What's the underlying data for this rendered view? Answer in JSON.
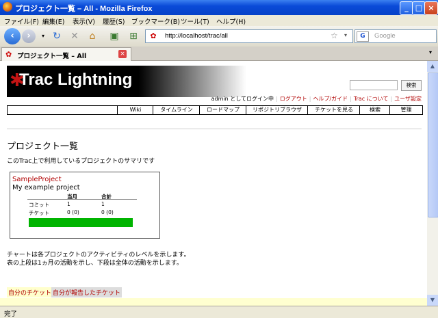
{
  "window": {
    "title": "プロジェクト一覧 – All - Mozilla Firefox",
    "buttons": {
      "minimize": "_",
      "maximize": "□",
      "close": "×"
    }
  },
  "menu": [
    "ファイル(F)",
    "編集(E)",
    "表示(V)",
    "履歴(S)",
    "ブックマーク(B)",
    "ツール(T)",
    "ヘルプ(H)"
  ],
  "toolbar": {
    "url": "http://localhost/trac/all",
    "search_placeholder": "Google",
    "search_engine_icon": "G"
  },
  "tab": {
    "label": "プロジェクト一覧 – All",
    "close": "×"
  },
  "trac": {
    "logo": "Trac Lightning",
    "search_button": "検索",
    "metanav": {
      "user": "admin としてログイン中",
      "logout": "ログアウト",
      "help": "ヘルプ/ガイド",
      "about": "Trac について",
      "prefs": "ユーザ設定"
    },
    "mainnav": [
      "Wiki",
      "タイムライン",
      "ロードマップ",
      "リポジトリブラウザ",
      "チケットを見る",
      "検索",
      "管理"
    ],
    "page_title": "プロジェクト一覧",
    "page_desc": "このTrac上で利用しているプロジェクトのサマリです",
    "project": {
      "name": "SampleProject",
      "description": "My example project",
      "headers": [
        "当月",
        "合計"
      ],
      "rows": [
        {
          "label": "コミット",
          "month": "1",
          "total": "1"
        },
        {
          "label": "チケット",
          "month": "0 (0)",
          "total": "0 (0)"
        }
      ]
    },
    "note_line1": "チャートは各プロジェクトのアクティビティのレベルを示します。",
    "note_line2": "表の上段は1ヵ月の活動を示し、下段は全体の活動を示します。",
    "links": [
      "自分のチケット",
      "自分が報告したチケット"
    ]
  },
  "status": "完了",
  "colors": {
    "accent": "#b00000",
    "activity_bar": "#00b400",
    "titlebar": "#0a4ad8"
  }
}
